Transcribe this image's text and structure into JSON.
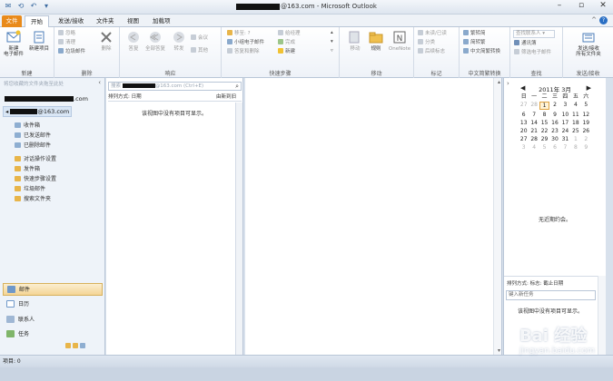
{
  "window": {
    "title_suffix": "@163.com - Microsoft Outlook",
    "minimize": "–",
    "restore": "▫",
    "close": "✕"
  },
  "tabs": [
    {
      "label": "文件"
    },
    {
      "label": "开始"
    },
    {
      "label": "发送/接收"
    },
    {
      "label": "文件夹"
    },
    {
      "label": "视图"
    },
    {
      "label": "加载项"
    }
  ],
  "help": {
    "caret": "^",
    "q": "?"
  },
  "ribbon": {
    "new": {
      "new_email": "新建\n电子邮件",
      "new_items": "新建项目",
      "group": "新建"
    },
    "delete": {
      "ignore": "忽略",
      "cleanup": "清理",
      "junk": "垃圾邮件",
      "delete": "删除",
      "group": "删除"
    },
    "respond": {
      "reply": "答复",
      "reply_all": "全部答复",
      "forward": "转发",
      "meeting": "会议",
      "more": "其他",
      "group": "响应"
    },
    "quicksteps": {
      "items": [
        "移至: ?",
        "小组电子邮件",
        "答复和删除",
        "给经理",
        "完成",
        "新建"
      ],
      "group": "快速步骤"
    },
    "move": {
      "move": "移动",
      "rules": "规则",
      "onenote": "OneNote",
      "group": "移动"
    },
    "tags": {
      "unread": "未读/已读",
      "categorize": "分类",
      "followup": "后续标志",
      "group": "标记"
    },
    "chinese": {
      "to_trad": "繁转简",
      "to_simp": "简转繁",
      "convert": "中文简繁转换",
      "group": "中文简繁转换"
    },
    "find": {
      "find_contact": "查找联系人",
      "address_book": "通讯簿",
      "filter": "筛选电子邮件",
      "group": "查找"
    },
    "sendrecv": {
      "send_all": "发送/接收\n所有文件夹",
      "group": "发送/接收"
    }
  },
  "nav": {
    "hint": "将您收藏的文件夹拖至此处",
    "account1_suffix": ".com",
    "account2_suffix": "@163.com",
    "folders": [
      "收件箱",
      "已发送邮件",
      "已删除邮件",
      "对话操作设置",
      "发件箱",
      "快速步骤设置",
      "垃圾邮件",
      "搜索文件夹"
    ],
    "modules": [
      "邮件",
      "日历",
      "联系人",
      "任务"
    ]
  },
  "list": {
    "search_prefix": "搜索",
    "search_suffix": "@163.com (Ctrl+E)",
    "sort_by": "排列方式: 日期",
    "sort_order": "由新到旧",
    "empty": "该视图中没有项目可显示。"
  },
  "todo": {
    "month": "2011年 3月",
    "day_names": [
      "日",
      "一",
      "二",
      "三",
      "四",
      "五",
      "六"
    ],
    "weeks": [
      [
        "27",
        "28",
        "1",
        "2",
        "3",
        "4",
        "5"
      ],
      [
        "6",
        "7",
        "8",
        "9",
        "10",
        "11",
        "12"
      ],
      [
        "13",
        "14",
        "15",
        "16",
        "17",
        "18",
        "19"
      ],
      [
        "20",
        "21",
        "22",
        "23",
        "24",
        "25",
        "26"
      ],
      [
        "27",
        "28",
        "29",
        "30",
        "31",
        "1",
        "2"
      ],
      [
        "3",
        "4",
        "5",
        "6",
        "7",
        "8",
        "9"
      ]
    ],
    "no_appointments": "无近期约会。",
    "task_sort": "排列方式: 标志: 截止日期",
    "task_input": "键入新任务",
    "task_empty": "该视图中没有项目可显示。"
  },
  "status": {
    "items": "项目: 0"
  },
  "watermark": {
    "text": "Bai 经验",
    "sub": "jingyan.baidu.com"
  }
}
